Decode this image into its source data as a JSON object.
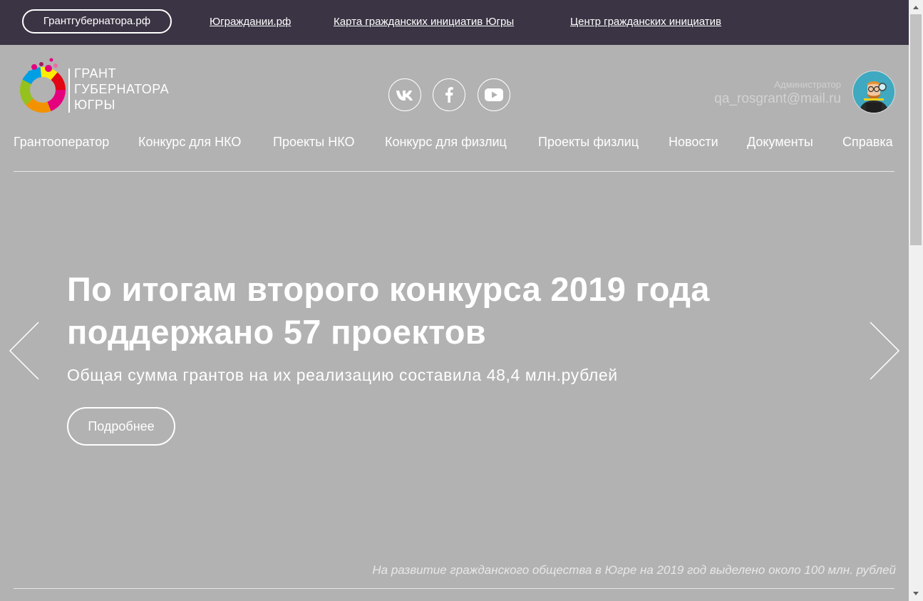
{
  "topbar": {
    "pill_label": "Грантгубернатора.рф",
    "links": [
      "Юграждании.рф",
      "Карта гражданских инициатив Югры",
      "Центр гражданских инициатив"
    ]
  },
  "logo": {
    "lines": [
      "ГРАНТ",
      "ГУБЕРНАТОРА",
      "ЮГРЫ"
    ],
    "icon": "colorful-ring-logo"
  },
  "social": [
    {
      "name": "vk",
      "icon": "vk-icon"
    },
    {
      "name": "facebook",
      "icon": "facebook-icon"
    },
    {
      "name": "youtube",
      "icon": "youtube-icon"
    }
  ],
  "user": {
    "role": "Администратор",
    "email": "qa_rosgrant@mail.ru"
  },
  "nav": [
    "Грантооператор",
    "Конкурс для НКО",
    "Проекты НКО",
    "Конкурс для физлиц",
    "Проекты физлиц",
    "Новости",
    "Документы",
    "Справка"
  ],
  "hero": {
    "title_line1": "По итогам второго конкурса 2019 года",
    "title_line2": "поддержано 57 проектов",
    "subtitle": "Общая сумма грантов на их реализацию составила 48,4 млн.рублей",
    "button_label": "Подробнее"
  },
  "footnote": "На развитие гражданского общества в Югре на 2019 год выделено около 100 млн. рублей",
  "colors": {
    "topbar_bg": "#3a3444",
    "hero_bg": "#b2b2b2",
    "text": "#ffffff"
  }
}
